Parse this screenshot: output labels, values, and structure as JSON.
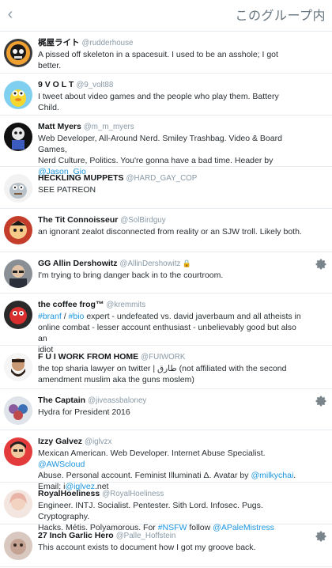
{
  "header": {
    "back_icon": "chevron-left-icon",
    "title": "このグループ内"
  },
  "accounts": [
    {
      "name": "梶屋ライト",
      "handle": "@rudderhouse",
      "bio": [
        "A pissed off skeleton in a spacesuit. I used to be an asshole; I got better."
      ],
      "protected": false,
      "gear": false
    },
    {
      "name": "9 V O L T",
      "handle": "@9_volt88",
      "bio": [
        "I tweet about video games and the people who play them. Battery Child."
      ],
      "protected": false,
      "gear": false
    },
    {
      "name": "Matt Myers",
      "handle": "@m_m_myers",
      "bio": [
        "Web Developer, All-Around Nerd. Smiley Trashbag. Video & Board Games,",
        "Nerd Culture, Politics. You're gonna have a bad time. Header by",
        "@Jason_Gio"
      ],
      "protected": false,
      "gear": false
    },
    {
      "name": "HECKLING MUPPETS",
      "handle": "@HARD_GAY_COP",
      "bio": [
        "SEE PATREON"
      ],
      "protected": false,
      "gear": false
    },
    {
      "name": "The Tit Connoisseur",
      "handle": "@SolBirdguy",
      "bio": [
        "an ignorant zealot disconnected from reality or an SJW troll. Likely both."
      ],
      "protected": false,
      "gear": false
    },
    {
      "name": "GG Allin Dershowitz",
      "handle": "@AllinDershowitz",
      "bio": [
        "I'm trying to bring danger back in to the courtroom."
      ],
      "protected": true,
      "gear": true
    },
    {
      "name": "the coffee frog™",
      "handle": "@kremmits",
      "bio": [
        "#branf / #bio expert - undefeated vs. david javerbaum and all atheists in",
        "online combat - lesser account enthusiast - unbelievably good but also an",
        "idiot"
      ],
      "protected": false,
      "gear": false
    },
    {
      "name": "F U I WORK FROM HOME",
      "handle": "@FUIWORK",
      "bio": [
        "the top sharia lawyer on twitter | طارق (not affiliated with the second",
        "amendment muslim aka the guns moslem)"
      ],
      "protected": false,
      "gear": false
    },
    {
      "name": "The Captain",
      "handle": "@jiveassbaloney",
      "bio": [
        "Hydra for President 2016"
      ],
      "protected": false,
      "gear": true
    },
    {
      "name": "Izzy Galvez",
      "handle": "@iglvzx",
      "bio": [
        "Mexican American. Web Developer. Internet Abuse Specialist. @AWScloud",
        "Abuse. Personal account. Feminist Illuminati Δ. Avatar by @milkychai.",
        "Email: i@iglvez.net"
      ],
      "protected": false,
      "gear": false
    },
    {
      "name": "RoyalHoeliness",
      "handle": "@RoyalHoeliness",
      "bio": [
        "Engineer. INTJ. Socialist. Pentester. Sith Lord. Infosec. Pugs. Cryptography.",
        "Hacks. Métis. Polyamorous. For #NSFW follow @APaleMistress"
      ],
      "protected": false,
      "gear": false
    },
    {
      "name": "27 Inch Garlic Hero",
      "handle": "@Palle_Hoffstein",
      "bio": [
        "This account exists to document how I got my groove back."
      ],
      "protected": false,
      "gear": true
    }
  ],
  "colors": {
    "link": "#1b95e0",
    "handle": "#8899a6",
    "divider": "#e6ecf0",
    "gear": "#7a848b"
  }
}
